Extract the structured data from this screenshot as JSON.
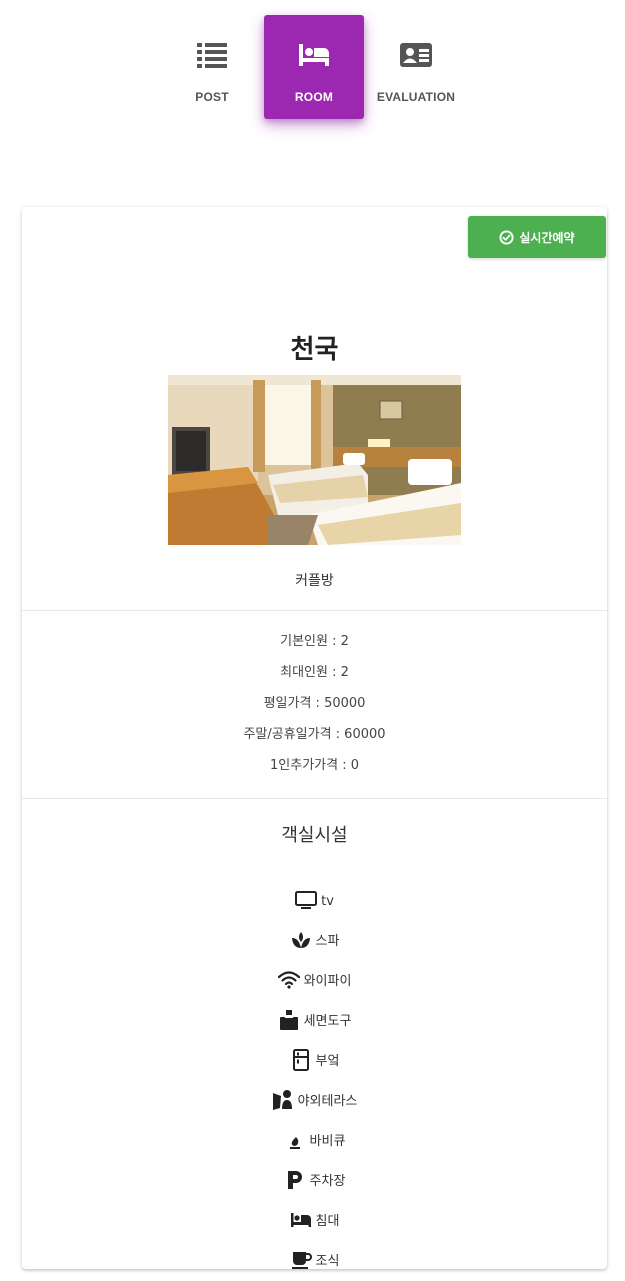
{
  "tabs": [
    {
      "label": "POST",
      "icon": "list-icon",
      "active": false
    },
    {
      "label": "ROOM",
      "icon": "bed-icon",
      "active": true
    },
    {
      "label": "EVALUATION",
      "icon": "id-card-icon",
      "active": false
    }
  ],
  "colors": {
    "active_tab": "#9c27b0",
    "reserve_button": "#4caf50",
    "text": "#333333",
    "inactive_tab_text": "#555555"
  },
  "room": {
    "reserve_label": "실시간예약",
    "reserve_icon": "check-circle-icon",
    "title": "천국",
    "photo": "hotel-room-photo",
    "type": "커플방",
    "info": {
      "base_people": "기본인원 : 2",
      "max_people": "최대인원 : 2",
      "weekday_price": "평일가격 : 50000",
      "weekend_price": "주말/공휴일가격 : 60000",
      "extra_person_price": "1인추가가격 : 0"
    },
    "facilities_heading": "객실시설",
    "facilities": [
      {
        "label": "tv",
        "icon": "tv-icon"
      },
      {
        "label": "스파",
        "icon": "spa-icon"
      },
      {
        "label": "와이파이",
        "icon": "wifi-icon"
      },
      {
        "label": "세면도구",
        "icon": "toiletries-icon"
      },
      {
        "label": "부엌",
        "icon": "kitchen-icon"
      },
      {
        "label": "야외테라스",
        "icon": "terrace-icon"
      },
      {
        "label": "바비큐",
        "icon": "fire-icon"
      },
      {
        "label": "주차장",
        "icon": "parking-icon"
      },
      {
        "label": "침대",
        "icon": "bed-icon"
      },
      {
        "label": "조식",
        "icon": "coffee-icon"
      }
    ]
  }
}
